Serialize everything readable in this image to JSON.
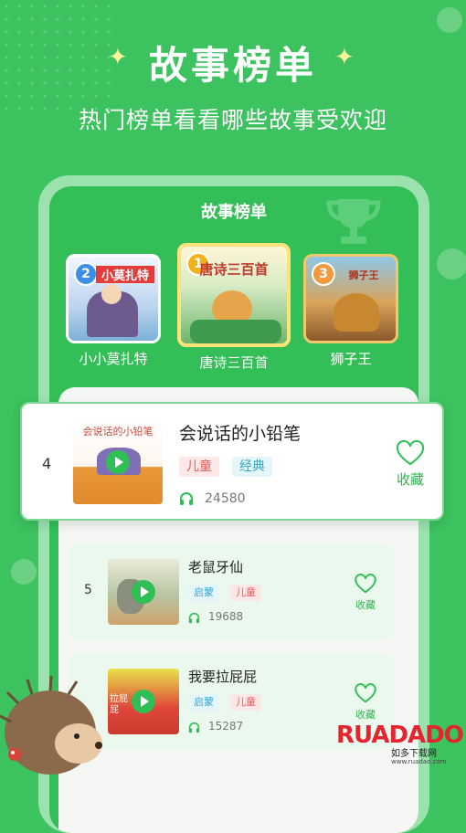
{
  "header": {
    "title": "故事榜单",
    "subtitle": "热门榜单看看哪些故事受欢迎"
  },
  "screen": {
    "title": "故事榜单"
  },
  "top3": [
    {
      "rank": "2",
      "name": "小小莫扎特",
      "cover_text": "小莫扎特",
      "badge_color": "#3b8fe6"
    },
    {
      "rank": "1",
      "name": "唐诗三百首",
      "cover_text": "唐诗三百首",
      "badge_color": "#f2b21c"
    },
    {
      "rank": "3",
      "name": "狮子王",
      "cover_text": "狮子王",
      "badge_color": "#f29a3c"
    }
  ],
  "featured": {
    "rank": "4",
    "title": "会说话的小铅笔",
    "cover_text": "会说话的小铅笔",
    "tags": [
      "儿童",
      "经典"
    ],
    "plays": "24580",
    "fav_label": "收藏"
  },
  "list": [
    {
      "rank": "5",
      "title": "老鼠牙仙",
      "tags": [
        "启蒙",
        "儿童"
      ],
      "plays": "19688",
      "fav_label": "收藏"
    },
    {
      "rank": "",
      "title": "我要拉屁屁",
      "cover_text": "拉屁屁",
      "tags": [
        "启蒙",
        "儿童"
      ],
      "plays": "15287",
      "fav_label": "收藏"
    }
  ],
  "watermark": {
    "brand": "RUADADO",
    "sub": "如多下载网",
    "url": "www.ruadao.com"
  },
  "colors": {
    "brand_green": "#3cc25e",
    "accent_green": "#2fbf54"
  }
}
